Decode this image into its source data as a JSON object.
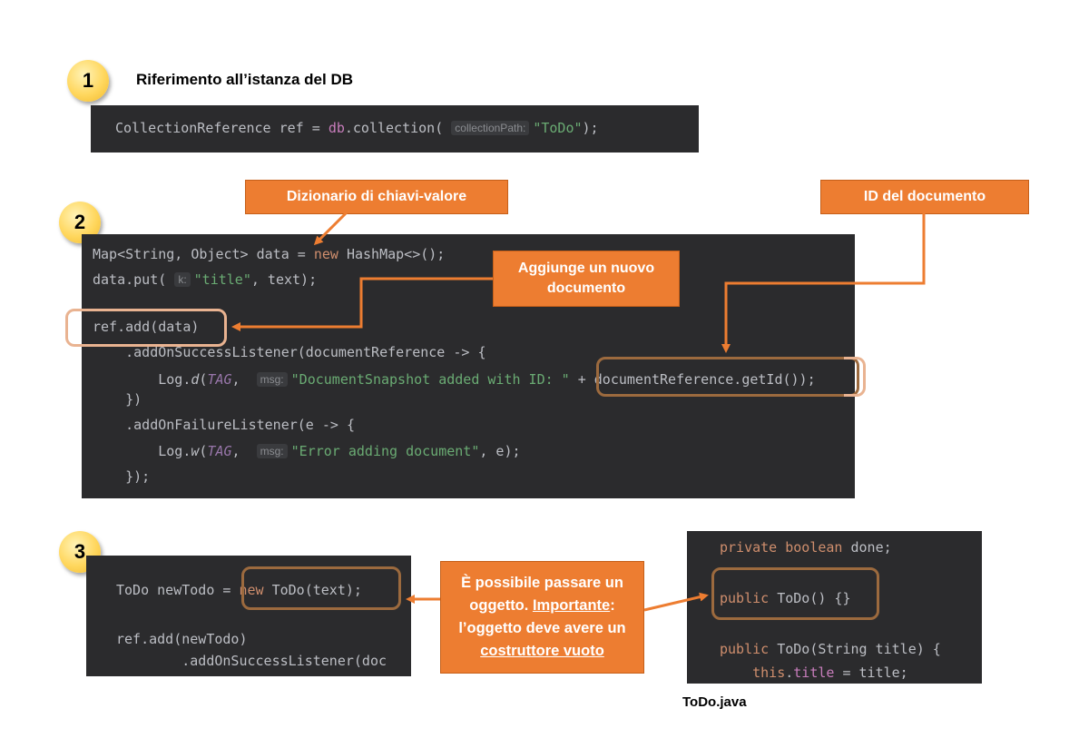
{
  "steps": [
    {
      "number": "1",
      "title": "Riferimento all’istanza del DB"
    },
    {
      "number": "2"
    },
    {
      "number": "3"
    }
  ],
  "block1": {
    "line1": {
      "a": "CollectionReference ref = ",
      "b": "db",
      "c": ".collection(",
      "hint": "collectionPath:",
      "str": "\"ToDo\"",
      "end": ");"
    }
  },
  "block2": {
    "lines": [
      {
        "a": "Map<String, Object> data = ",
        "kw": "new",
        "b": " HashMap<>();"
      },
      {
        "a": "data.put(",
        "hint": "k:",
        "str": "\"title\"",
        "b": ", text);"
      },
      {
        "a": "ref.add(data)"
      },
      {
        "a": "    .addOnSuccessListener(documentReference -> {"
      },
      {
        "a": "        Log.",
        "m": "d",
        "b": "(",
        "c": "TAG",
        "d": ", ",
        "hint": "msg:",
        "str": "\"DocumentSnapshot added with ID: \"",
        "e": " + documentReference.getId());"
      },
      {
        "a": "    })"
      },
      {
        "a": "    .addOnFailureListener(e -> {"
      },
      {
        "a": "        Log.",
        "m": "w",
        "b": "(",
        "c": "TAG",
        "d": ", ",
        "hint": "msg:",
        "str": "\"Error adding document\"",
        "e": ", e);"
      },
      {
        "a": "    });"
      }
    ]
  },
  "block3a": {
    "lines": [
      {
        "a": "ToDo newTodo = ",
        "kw": "new",
        "b": " ToDo(text);"
      },
      {
        "a": "ref.add(newTodo)"
      },
      {
        "a": "        .addOnSuccessListener(doc"
      }
    ]
  },
  "block3b": {
    "lines": [
      {
        "kw": "private boolean",
        "a": " done;"
      },
      {
        "kw": "public",
        "a": " ToDo() {}"
      },
      {
        "kw": "public",
        "a": " ToDo(String title) {"
      },
      {
        "kw": "    this",
        "a": ".",
        "fld": "title",
        "b": " = title;"
      }
    ],
    "caption": "ToDo.java"
  },
  "callouts": {
    "dizionario": "Dizionario di chiavi-valore",
    "id": "ID del documento",
    "aggiunge": "Aggiunge un nuovo documento",
    "passare": {
      "p1": "È possibile passare un oggetto. ",
      "imp": "Importante",
      "p2": ": l’oggetto deve avere un ",
      "cost": "costruttore vuoto"
    }
  },
  "colors": {
    "accent": "#ed7d31",
    "code_bg": "#2b2b2d",
    "highlight": "#9c6a3e"
  }
}
